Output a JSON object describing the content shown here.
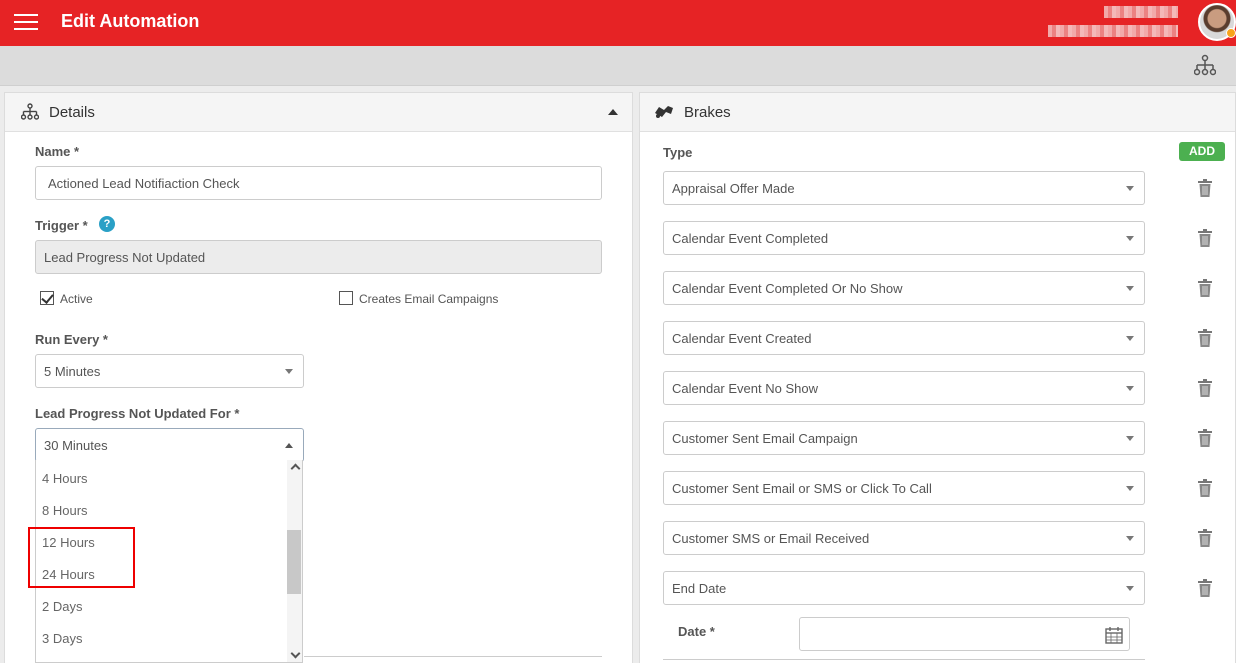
{
  "header": {
    "title": "Edit Automation",
    "menu_icon": "hamburger-menu-icon",
    "avatar_icon": "user-avatar"
  },
  "details": {
    "title": "Details",
    "name_label": "Name *",
    "name_value": "Actioned Lead Notifiaction Check",
    "trigger_label": "Trigger *",
    "trigger_help": "?",
    "trigger_value": "Lead Progress Not Updated",
    "active_label": "Active",
    "active_checked": true,
    "creates_email_label": "Creates Email Campaigns",
    "creates_email_checked": false,
    "run_every_label": "Run Every *",
    "run_every_value": "5 Minutes",
    "not_updated_label": "Lead Progress Not Updated For *",
    "not_updated_value": "30 Minutes",
    "dropdown_options": [
      "4 Hours",
      "8 Hours",
      "12 Hours",
      "24 Hours",
      "2 Days",
      "3 Days"
    ]
  },
  "brakes": {
    "title": "Brakes",
    "type_label": "Type",
    "add_label": "ADD",
    "types": [
      "Appraisal Offer Made",
      "Calendar Event Completed",
      "Calendar Event Completed Or No Show",
      "Calendar Event Created",
      "Calendar Event No Show",
      "Customer Sent Email Campaign",
      "Customer Sent Email or SMS or Click To Call",
      "Customer SMS or Email Received",
      "End Date"
    ],
    "date_label": "Date *",
    "date_value": ""
  },
  "colors": {
    "brand_red": "#e62325",
    "add_green": "#4cb050",
    "help_blue": "#2aa0c6",
    "highlight_red": "#ee0000"
  }
}
